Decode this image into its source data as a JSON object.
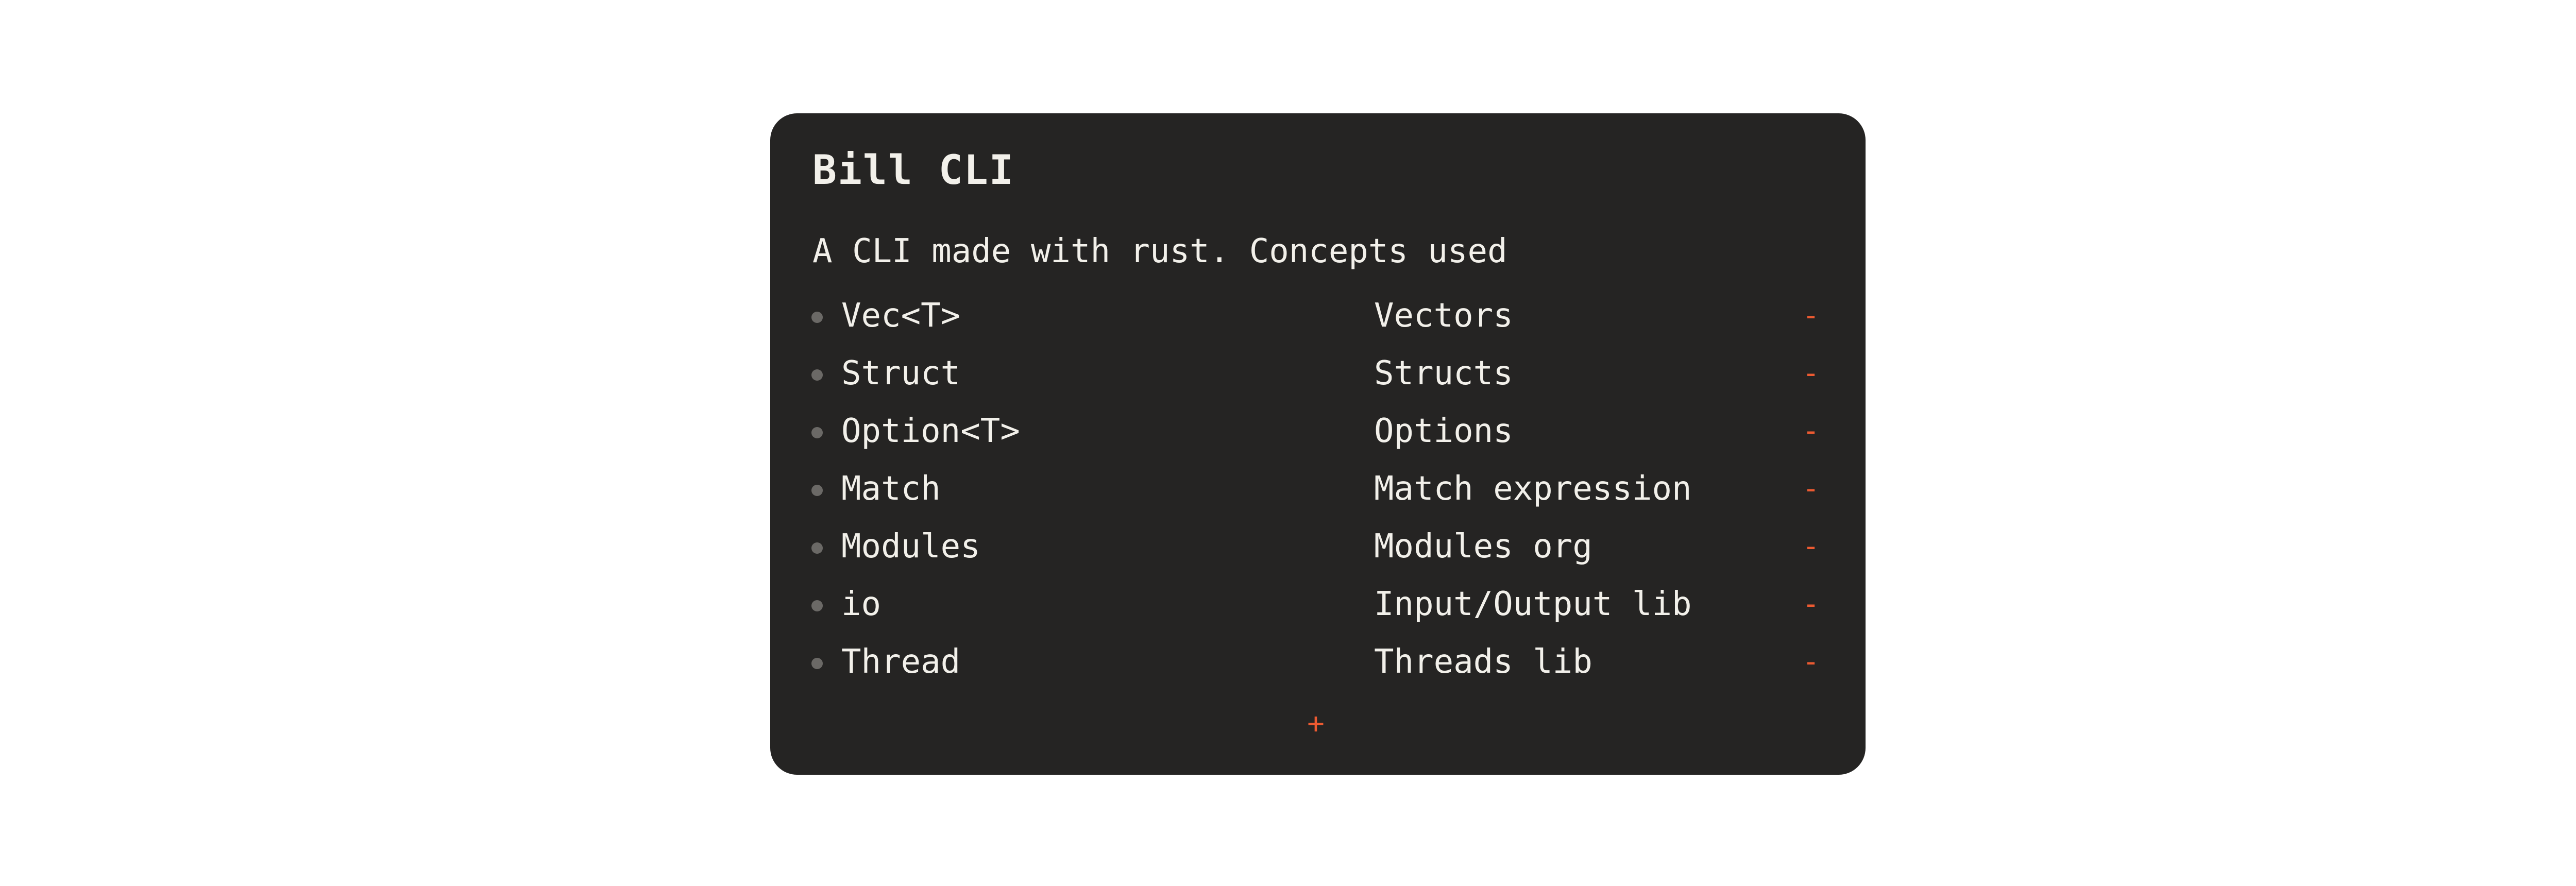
{
  "card": {
    "title": "Bill CLI",
    "subtitle": "A CLI made with rust. Concepts used",
    "items": [
      {
        "name": "Vec<T>",
        "description": "Vectors",
        "remove_label": "-"
      },
      {
        "name": "Struct",
        "description": "Structs",
        "remove_label": "-"
      },
      {
        "name": "Option<T>",
        "description": "Options",
        "remove_label": "-"
      },
      {
        "name": "Match",
        "description": "Match expression",
        "remove_label": "-"
      },
      {
        "name": "Modules",
        "description": "Modules org",
        "remove_label": "-"
      },
      {
        "name": "io",
        "description": "Input/Output lib",
        "remove_label": "-"
      },
      {
        "name": "Thread",
        "description": "Threads lib",
        "remove_label": "-"
      }
    ],
    "add_label": "+"
  },
  "colors": {
    "page_background": "#ffffff",
    "card_background": "#252423",
    "text": "#f2f0ea",
    "accent": "#ec5a31",
    "bullet": "#6b6966"
  },
  "icons": {
    "bullet": "bullet-dot-icon",
    "remove": "minus-icon",
    "add": "plus-icon"
  }
}
